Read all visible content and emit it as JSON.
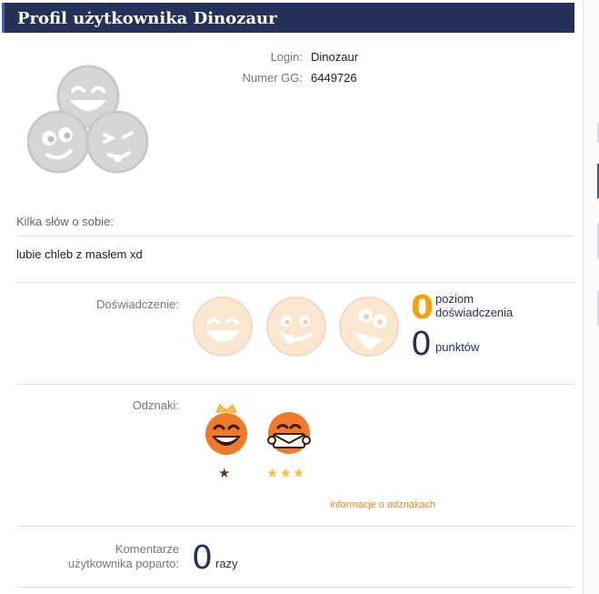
{
  "header": {
    "title": "Profil użytkownika Dinozaur"
  },
  "info": {
    "login_label": "Login:",
    "login_value": "Dinozaur",
    "gg_label": "Numer GG:",
    "gg_value": "6449726"
  },
  "about": {
    "label": "Kilka słów o sobie:",
    "text": "lubie chleb z masłem xd"
  },
  "experience": {
    "label": "Doświadczenie:",
    "level_value": "0",
    "level_caption_line1": "poziom",
    "level_caption_line2": "doświadczenia",
    "points_value": "0",
    "points_caption": "punktów",
    "faces": [
      "laughing-face-icon",
      "tongue-face-icon",
      "crazy-face-icon"
    ]
  },
  "badges": {
    "label": "Odznaki:",
    "items": [
      {
        "icon": "crowned-laughing-face-icon",
        "stars": "★",
        "star_color": "#5a3a2a"
      },
      {
        "icon": "envelope-face-icon",
        "stars": "★★★",
        "star_color": "#f5c046"
      }
    ],
    "link_text": "informacje o odznakach"
  },
  "comments": {
    "label_line1": "Komentarze",
    "label_line2": "użytkownika poparto:",
    "value": "0",
    "unit": "razy"
  },
  "colors": {
    "header_bg": "#253158",
    "accent_orange": "#f2a20e",
    "dark_navy": "#253158",
    "link_orange": "#e8871a"
  }
}
